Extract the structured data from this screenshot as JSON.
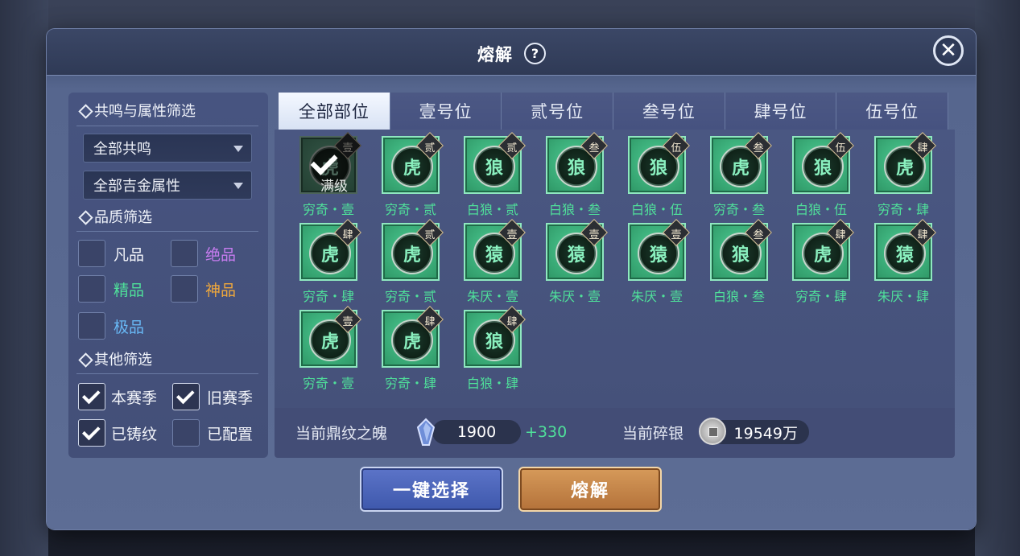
{
  "dialog": {
    "title": "熔解",
    "help_icon": "question-icon",
    "close_icon": "close-icon"
  },
  "filters": {
    "resonance_section": "共鸣与属性筛选",
    "resonance_dropdown": "全部共鸣",
    "attribute_dropdown": "全部吉金属性",
    "quality_section": "品质筛选",
    "quality_options": [
      {
        "label": "凡品",
        "checked": false,
        "color": "#f3f5fa"
      },
      {
        "label": "绝品",
        "checked": false,
        "color": "#c77cf0"
      },
      {
        "label": "精品",
        "checked": false,
        "color": "#4fe09a"
      },
      {
        "label": "神品",
        "checked": false,
        "color": "#f0a83c"
      },
      {
        "label": "极品",
        "checked": false,
        "color": "#68b8f5"
      }
    ],
    "other_section": "其他筛选",
    "other_options": [
      {
        "label": "本赛季",
        "checked": true
      },
      {
        "label": "旧赛季",
        "checked": true
      },
      {
        "label": "已铸纹",
        "checked": true
      },
      {
        "label": "已配置",
        "checked": false
      }
    ]
  },
  "tabs": [
    {
      "label": "全部部位",
      "active": true
    },
    {
      "label": "壹号位",
      "active": false
    },
    {
      "label": "贰号位",
      "active": false
    },
    {
      "label": "叁号位",
      "active": false
    },
    {
      "label": "肆号位",
      "active": false
    },
    {
      "label": "伍号位",
      "active": false
    }
  ],
  "items": [
    {
      "name": "穷奇・壹",
      "slot": "壹",
      "selected": true,
      "status": "满级"
    },
    {
      "name": "穷奇・贰",
      "slot": "贰"
    },
    {
      "name": "白狼・贰",
      "slot": "贰"
    },
    {
      "name": "白狼・叁",
      "slot": "叁"
    },
    {
      "name": "白狼・伍",
      "slot": "伍"
    },
    {
      "name": "穷奇・叁",
      "slot": "叁"
    },
    {
      "name": "白狼・伍",
      "slot": "伍"
    },
    {
      "name": "穷奇・肆",
      "slot": "肆"
    },
    {
      "name": "穷奇・肆",
      "slot": "肆"
    },
    {
      "name": "穷奇・贰",
      "slot": "贰"
    },
    {
      "name": "朱厌・壹",
      "slot": "壹"
    },
    {
      "name": "朱厌・壹",
      "slot": "壹"
    },
    {
      "name": "朱厌・壹",
      "slot": "壹"
    },
    {
      "name": "白狼・叁",
      "slot": "叁"
    },
    {
      "name": "穷奇・肆",
      "slot": "肆"
    },
    {
      "name": "朱厌・肆",
      "slot": "肆"
    },
    {
      "name": "穷奇・壹",
      "slot": "壹"
    },
    {
      "name": "穷奇・肆",
      "slot": "肆"
    },
    {
      "name": "白狼・肆",
      "slot": "肆"
    }
  ],
  "resources": {
    "soul_label": "当前鼎纹之魄",
    "soul_value": "1900",
    "soul_bonus": "+330",
    "silver_label": "当前碎银",
    "silver_value": "19549万"
  },
  "buttons": {
    "select_all": "一键选择",
    "smelt": "熔解"
  }
}
